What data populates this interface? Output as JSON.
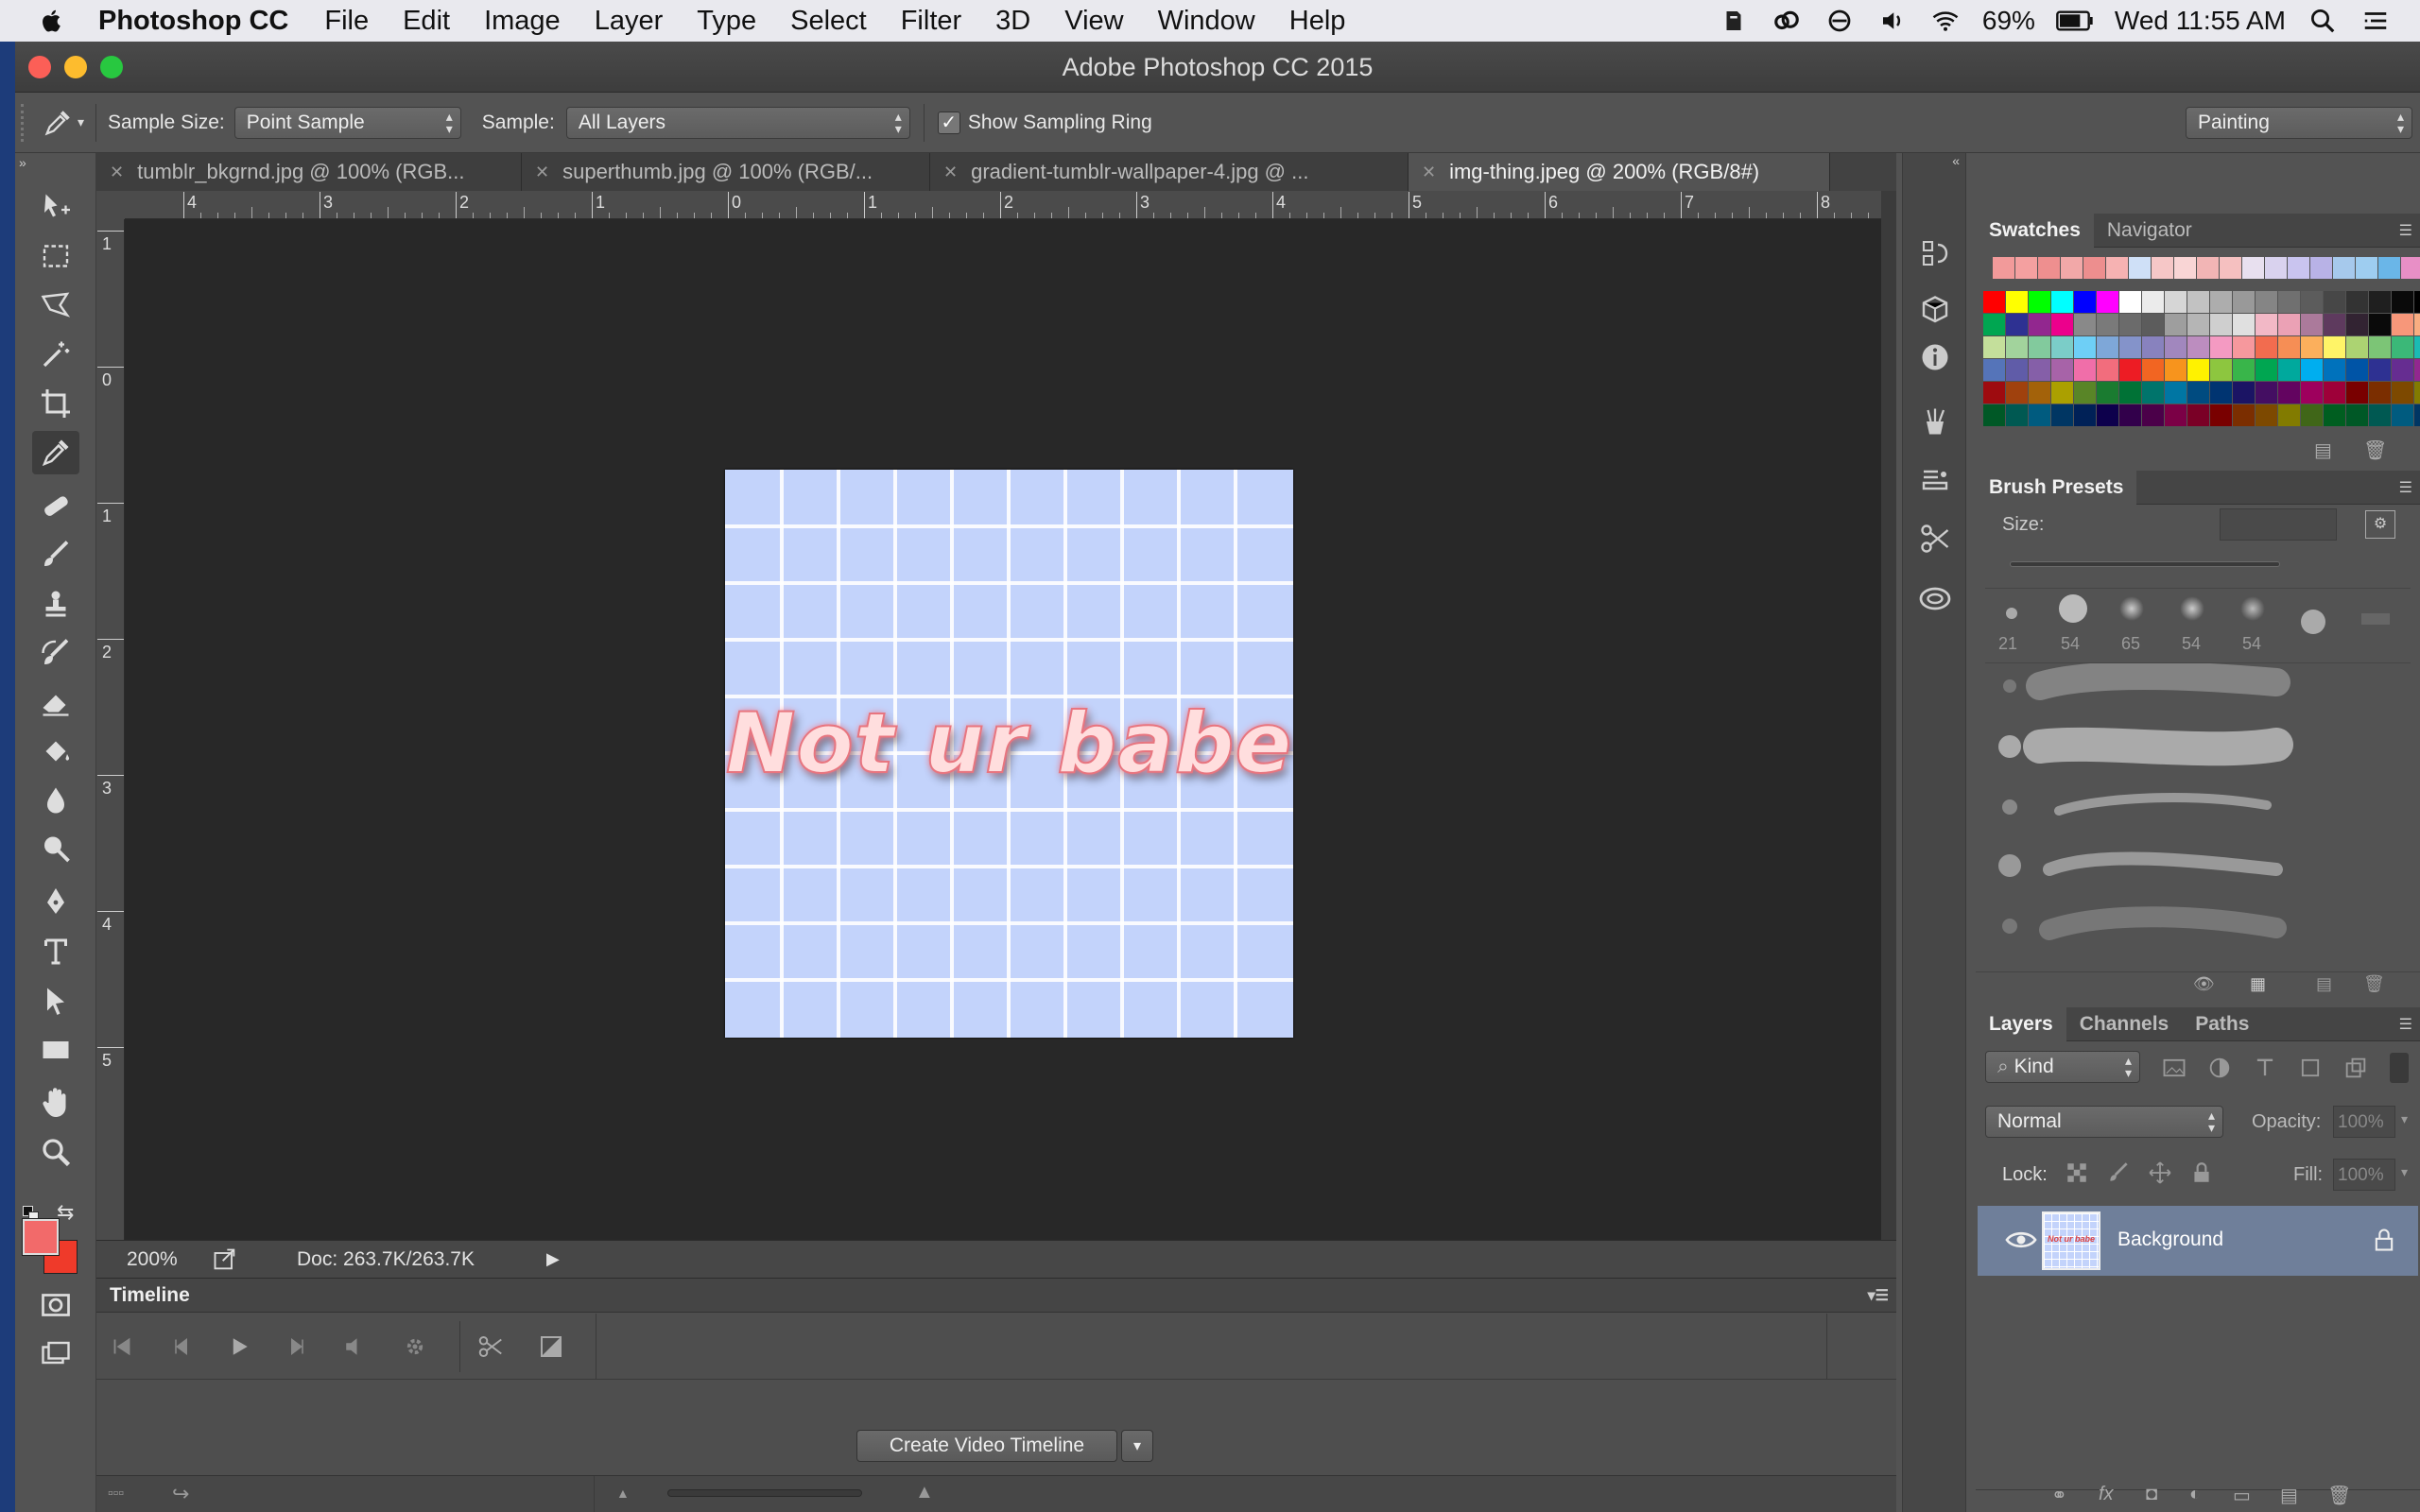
{
  "menubar": {
    "app_name": "Photoshop CC",
    "items": [
      "File",
      "Edit",
      "Image",
      "Layer",
      "Type",
      "Select",
      "Filter",
      "3D",
      "View",
      "Window",
      "Help"
    ],
    "battery": "69%",
    "clock": "Wed 11:55 AM"
  },
  "window": {
    "title": "Adobe Photoshop CC 2015"
  },
  "options": {
    "sample_size_label": "Sample Size:",
    "sample_size_value": "Point Sample",
    "sample_label": "Sample:",
    "sample_value": "All Layers",
    "sampling_ring_label": "Show Sampling Ring",
    "sampling_ring_checked": true,
    "workspace": "Painting"
  },
  "tabs": [
    {
      "label": "tumblr_bkgrnd.jpg @ 100% (RGB...",
      "active": false
    },
    {
      "label": "superthumb.jpg @ 100% (RGB/...",
      "active": false
    },
    {
      "label": "gradient-tumblr-wallpaper-4.jpg @ ...",
      "active": false
    },
    {
      "label": "img-thing.jpeg @ 200% (RGB/8#)",
      "active": true
    }
  ],
  "rulers": {
    "top": [
      "4",
      "3",
      "2",
      "1",
      "0",
      "1",
      "2",
      "3",
      "4",
      "5",
      "6",
      "7",
      "8"
    ],
    "left": [
      "1",
      "0",
      "1",
      "2",
      "3",
      "4",
      "5"
    ]
  },
  "document": {
    "image_text": "Not ur babe",
    "background_color": "#c3d3fb",
    "text_color": "#ffdede",
    "text_outline_color": "#e8757f"
  },
  "status": {
    "zoom": "200%",
    "doc_size": "Doc: 263.7K/263.7K"
  },
  "timeline": {
    "title": "Timeline",
    "create_button": "Create Video Timeline"
  },
  "swatches": {
    "tabs": [
      "Swatches",
      "Navigator"
    ],
    "recent": [
      "#f29a9a",
      "#f4a0a0",
      "#ee8f8f",
      "#f2a8a8",
      "#ed8e8e",
      "#f6b2b2",
      "#cfe0f7",
      "#f6c7c7",
      "#f9d5d5",
      "#f2b5b5",
      "#f5c0c0",
      "#e8e0ef",
      "#d9d2ee",
      "#c9c4ef",
      "#b8b2e6",
      "#a6c9ec",
      "#9ecdf0",
      "#6ab6e8",
      "#e88fc6"
    ],
    "rows": [
      [
        "#ff0000",
        "#ffff00",
        "#00ff00",
        "#00ffff",
        "#0000ff",
        "#ff00ff",
        "#ffffff",
        "#ebebeb",
        "#d6d6d6",
        "#c2c2c2",
        "#adadad",
        "#999999",
        "#858585",
        "#707070",
        "#5c5c5c",
        "#474747",
        "#333333",
        "#1f1f1f",
        "#0a0a0a",
        "#000000",
        "#ed1c24",
        "#ffff00"
      ],
      [
        "#00a651",
        "#2e3192",
        "#92278f",
        "#ec008c",
        "#898989",
        "#7a7a7a",
        "#6b6b6b",
        "#5c5c5c",
        "#9e9e9e",
        "#b5b5b5",
        "#cfcfcf",
        "#e0e0e0",
        "#f2b8c6",
        "#eba1b5",
        "#ab7a9b",
        "#5e3a5e",
        "#322332",
        "#0a0a0a",
        "#f7977a",
        "#f9ad81",
        "#fdc68a",
        "#fff79a"
      ],
      [
        "#c4df9b",
        "#a2d39c",
        "#82ca9d",
        "#7bcdc8",
        "#6ecff6",
        "#7ea7d8",
        "#8493ca",
        "#8882be",
        "#a187be",
        "#bc8dbf",
        "#f49ac2",
        "#f6989d",
        "#f26c4f",
        "#f68e55",
        "#fbaf5c",
        "#fff467",
        "#acd372",
        "#7cc576",
        "#3bb878",
        "#1abbb4",
        "#00bff3",
        "#438cca"
      ],
      [
        "#5574b9",
        "#605ca8",
        "#855fa8",
        "#a763a8",
        "#f06ea9",
        "#f26d7d",
        "#ed1c24",
        "#f26522",
        "#f7941d",
        "#fff200",
        "#8dc63f",
        "#39b54a",
        "#00a651",
        "#00a99d",
        "#00aeef",
        "#0072bc",
        "#0054a6",
        "#2e3192",
        "#662d91",
        "#92278f",
        "#ec008c",
        "#ed145b"
      ],
      [
        "#9e0b0f",
        "#a0410d",
        "#a3620a",
        "#aba000",
        "#598527",
        "#1a7b30",
        "#007236",
        "#00746b",
        "#0076a3",
        "#004b80",
        "#003471",
        "#1b1464",
        "#440e62",
        "#630460",
        "#9e005d",
        "#9e0039",
        "#790000",
        "#7b2e00",
        "#7d4900",
        "#827b00",
        "#406618",
        "#005e20"
      ],
      [
        "#005826",
        "#005952",
        "#005b7f",
        "#003663",
        "#002157",
        "#0d004c",
        "#32004b",
        "#4b0049",
        "#7b0046",
        "#7a0026",
        "#790000",
        "#7b2e00",
        "#7d4900",
        "#827b00",
        "#406618",
        "#005e20",
        "#005826",
        "#005952",
        "#005b7f",
        "#003663",
        "#002157",
        "#0d004c"
      ]
    ]
  },
  "brush_presets": {
    "title": "Brush Presets",
    "size_label": "Size:",
    "tips": [
      "21",
      "54",
      "65",
      "54",
      "54"
    ]
  },
  "layers": {
    "tabs": [
      "Layers",
      "Channels",
      "Paths"
    ],
    "filter_kind": "Kind",
    "blend_mode": "Normal",
    "opacity_label": "Opacity:",
    "opacity_value": "100%",
    "lock_label": "Lock:",
    "fill_label": "Fill:",
    "fill_value": "100%",
    "items": [
      {
        "name": "Background",
        "thumb_text": "Not ur babe"
      }
    ]
  },
  "colors": {
    "foreground": "#f26a6a",
    "background": "#ef3a2a"
  }
}
